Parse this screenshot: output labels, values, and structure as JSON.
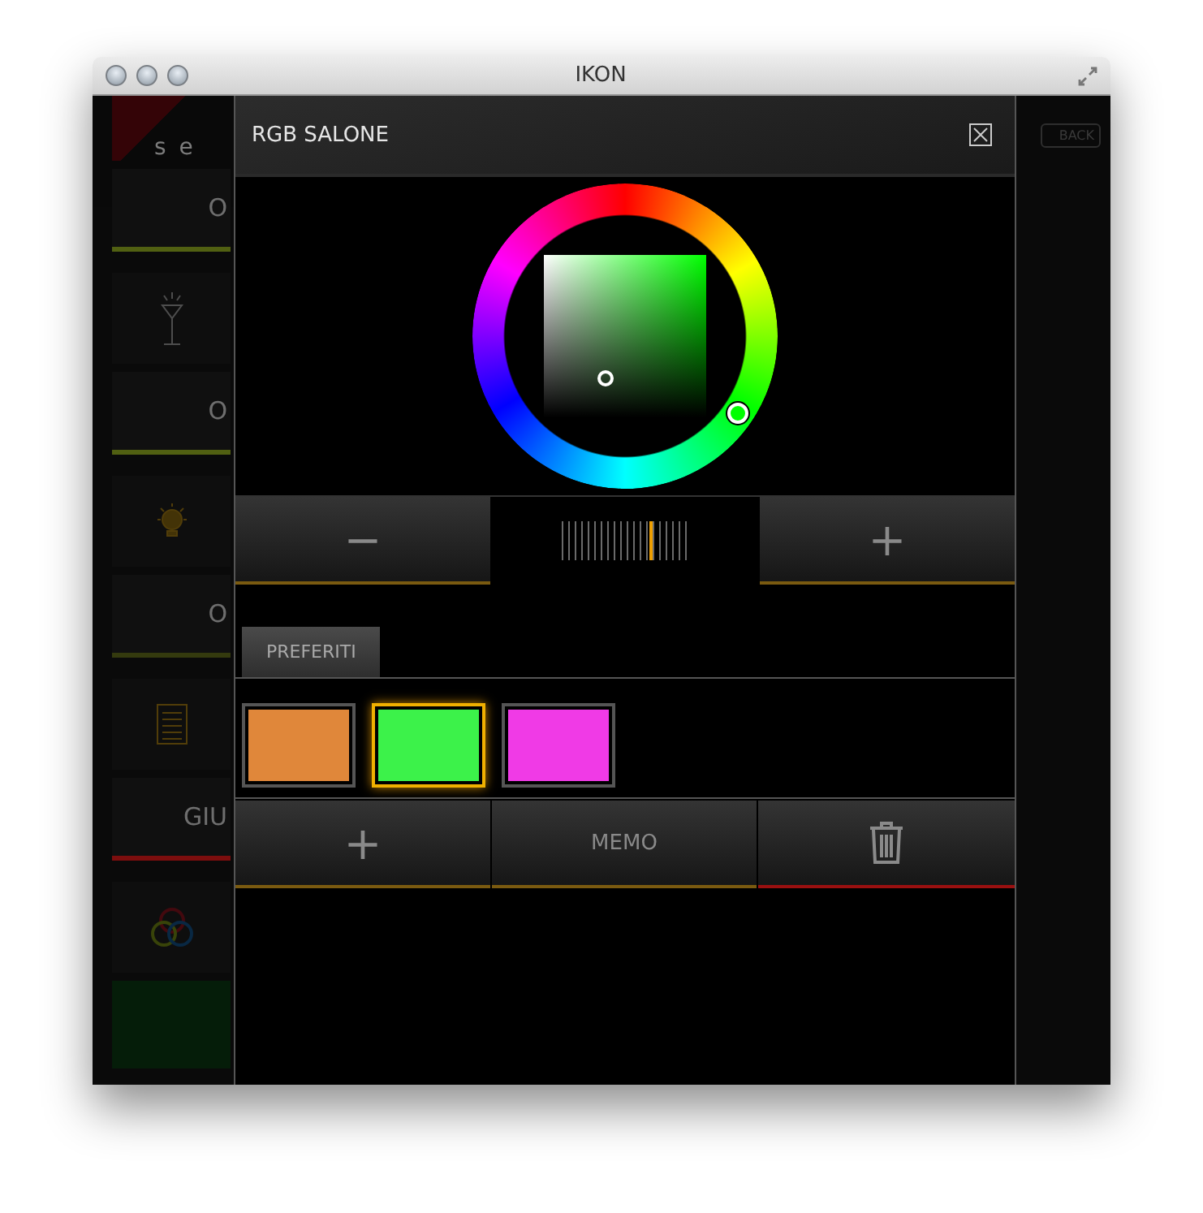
{
  "window": {
    "title": "IKON"
  },
  "sidebar": [
    {
      "kind": "logo",
      "text": "se"
    },
    {
      "kind": "label",
      "text": "O",
      "color": "#5a6a14"
    },
    {
      "kind": "lamp"
    },
    {
      "kind": "label",
      "text": "O",
      "color": "#5a6a14"
    },
    {
      "kind": "bulb"
    },
    {
      "kind": "label",
      "text": "O",
      "color": "#3a4010"
    },
    {
      "kind": "grid"
    },
    {
      "kind": "label",
      "text": "GIU",
      "color": "#8a1010"
    },
    {
      "kind": "rings"
    },
    {
      "kind": "block"
    }
  ],
  "back_button": "BACK",
  "dialog": {
    "title": "RGB SALONE",
    "minus_button": "−",
    "plus_button": "+",
    "slider": {
      "level": 0.69
    },
    "tabs": [
      {
        "label": "PREFERITI",
        "selected": true
      }
    ],
    "favorites": [
      {
        "color": "#e0873a",
        "selected": false
      },
      {
        "color": "#3cf24a",
        "selected": true
      },
      {
        "color": "#f03ae6",
        "selected": false
      }
    ],
    "actions": [
      {
        "kind": "add",
        "label": "+",
        "color": "#7a5a10"
      },
      {
        "kind": "text",
        "label": "MEMO",
        "color": "#7a5a10"
      },
      {
        "kind": "delete",
        "color": "#9a1010"
      }
    ]
  }
}
